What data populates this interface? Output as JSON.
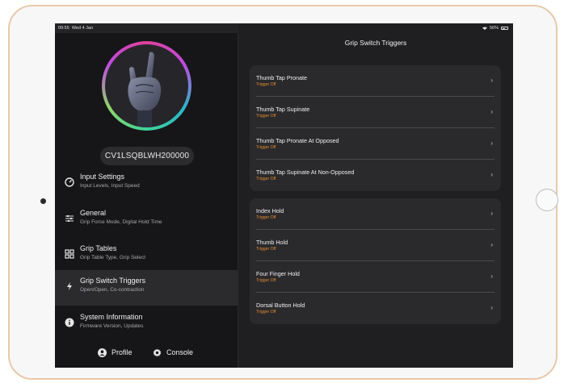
{
  "status": {
    "time": "09:55",
    "date": "Wed 4 Jan",
    "battery": "56%"
  },
  "sidebar": {
    "serial": "CV1LSQBLWH200000",
    "items": [
      {
        "title": "Input Settings",
        "subtitle": "Input Levels, Input Speed",
        "icon": "gauge-icon"
      },
      {
        "title": "General",
        "subtitle": "Grip Force Mode, Digital Hold Time",
        "icon": "sliders-icon"
      },
      {
        "title": "Grip Tables",
        "subtitle": "Grip Table Type, Grip Select",
        "icon": "grid-icon"
      },
      {
        "title": "Grip Switch Triggers",
        "subtitle": "Open/Open, Co-contraction",
        "icon": "lightning-icon"
      },
      {
        "title": "System Information",
        "subtitle": "Firmware Version, Updates",
        "icon": "info-icon"
      }
    ],
    "footer": {
      "profile": "Profile",
      "console": "Console"
    }
  },
  "main": {
    "title": "Grip Switch Triggers",
    "groups": [
      [
        {
          "title": "Thumb Tap Pronate",
          "status": "Trigger Off"
        },
        {
          "title": "Thumb Tap Supinate",
          "status": "Trigger Off"
        },
        {
          "title": "Thumb Tap Pronate At Opposed",
          "status": "Trigger Off"
        },
        {
          "title": "Thumb Tap Supinate At Non-Opposed",
          "status": "Trigger Off"
        }
      ],
      [
        {
          "title": "Index Hold",
          "status": "Trigger Off"
        },
        {
          "title": "Thumb Hold",
          "status": "Trigger Off"
        },
        {
          "title": "Four Finger Hold",
          "status": "Trigger Off"
        },
        {
          "title": "Dorsal Button Hold",
          "status": "Trigger Off"
        }
      ]
    ]
  },
  "colors": {
    "accent_status": "#e08a2e",
    "background": "#1b1b1d",
    "frame_gold": "#e9c9a9"
  }
}
